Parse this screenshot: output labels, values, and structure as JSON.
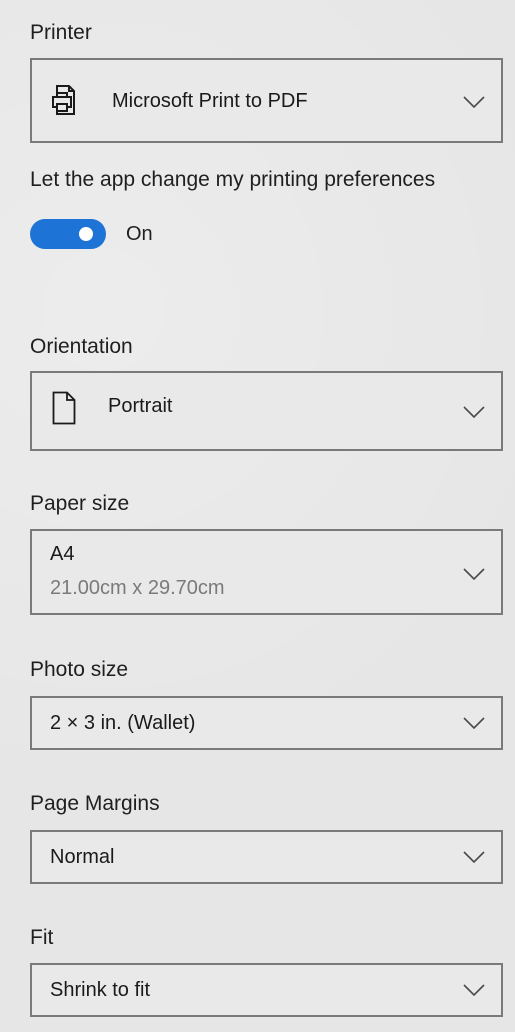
{
  "printer": {
    "label": "Printer",
    "value": "Microsoft Print to PDF",
    "icon": "printer-icon"
  },
  "preferences": {
    "label": "Let the app change my printing preferences",
    "toggle_state": "On",
    "enabled": true
  },
  "orientation": {
    "label": "Orientation",
    "value": "Portrait",
    "icon": "page-icon"
  },
  "paper_size": {
    "label": "Paper size",
    "value": "A4",
    "dimensions": "21.00cm x 29.70cm"
  },
  "photo_size": {
    "label": "Photo size",
    "value": "2 × 3 in. (Wallet)"
  },
  "page_margins": {
    "label": "Page Margins",
    "value": "Normal"
  },
  "fit": {
    "label": "Fit",
    "value": "Shrink to fit"
  },
  "colors": {
    "accent": "#1e74d6",
    "background": "#e6e6e6",
    "border": "#7a7a7a"
  }
}
